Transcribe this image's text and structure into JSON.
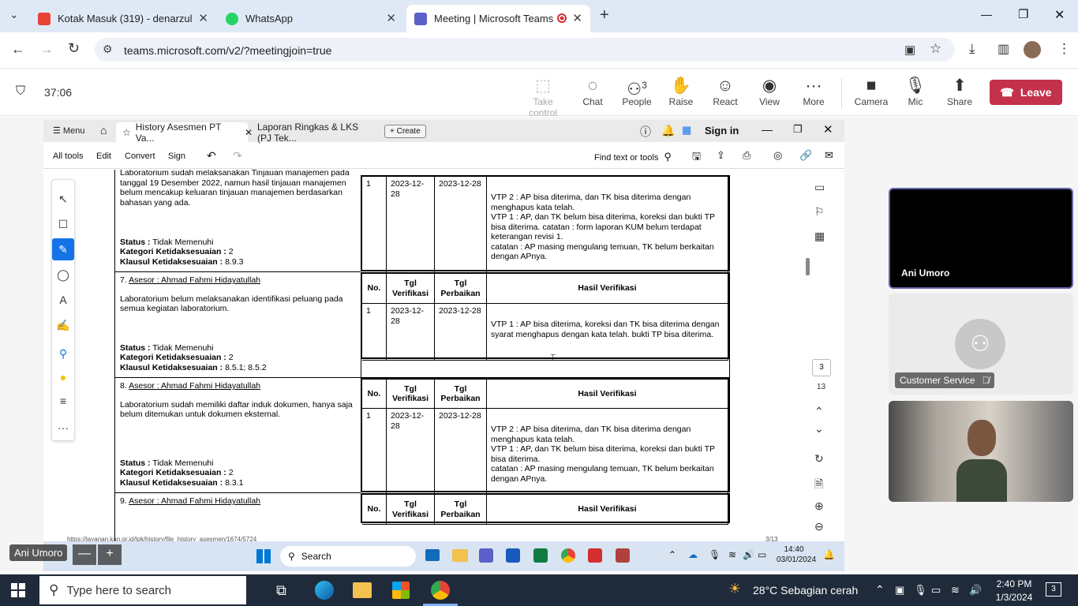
{
  "browser": {
    "tabs": [
      {
        "title": "Kotak Masuk (319) - denarzulia",
        "icon": "gmail-icon",
        "color": "#ea4335"
      },
      {
        "title": "WhatsApp",
        "icon": "whatsapp-icon",
        "color": "#25d366"
      },
      {
        "title": "Meeting | Microsoft Teams",
        "icon": "teams-icon",
        "color": "#5b5fc7"
      }
    ],
    "new_tab": "+",
    "url": "teams.microsoft.com/v2/?meetingjoin=true",
    "window_controls": {
      "minimize": "—",
      "restore": "❐",
      "close": "✕"
    }
  },
  "meeting": {
    "timer": "37:06",
    "buttons": [
      {
        "label": "Take control",
        "icon": "take-control-icon",
        "glyph": "⬚"
      },
      {
        "label": "Chat",
        "icon": "chat-icon",
        "glyph": "💬"
      },
      {
        "label": "People",
        "icon": "people-icon",
        "glyph": "👤",
        "count": "3"
      },
      {
        "label": "Raise",
        "icon": "raise-hand-icon",
        "glyph": "✋"
      },
      {
        "label": "React",
        "icon": "react-icon",
        "glyph": "☺"
      },
      {
        "label": "View",
        "icon": "view-icon",
        "glyph": "◉"
      },
      {
        "label": "More",
        "icon": "more-icon",
        "glyph": "···"
      },
      {
        "label": "Camera",
        "icon": "camera-icon",
        "glyph": "▶"
      },
      {
        "label": "Mic",
        "icon": "mic-icon",
        "glyph": "🎙"
      },
      {
        "label": "Share",
        "icon": "share-icon",
        "glyph": "⬆"
      }
    ],
    "leave": "Leave"
  },
  "acrobat": {
    "menu": "Menu",
    "tabs": [
      "History Asesmen PT Va...",
      "Laporan Ringkas & LKS (PJ Tek..."
    ],
    "create": "+ Create",
    "sign_in": "Sign in",
    "toolbar": [
      "All tools",
      "Edit",
      "Convert",
      "Sign"
    ],
    "find": "Find text or tools",
    "page_current": "3",
    "page_total": "13",
    "footer_url": "https://layanan.kan.or.id/lpk/history/file_history_asesmen/1674/5724",
    "footer_page": "3/13"
  },
  "document": {
    "first": {
      "text": "Laboratorium sudah melaksanakan Tinjauan manajemen pada tanggal 19 Desember 2022, namun hasil tinjauan manajemen belum mencakup keluaran tinjauan manajemen berdasarkan bahasan yang ada.",
      "status": "Tidak Memenuhi",
      "kategori": "2",
      "klausul": "8.9.3",
      "no": "1",
      "tgl_ver": "2023-12-28",
      "tgl_per": "2023-12-28",
      "hasil": "VTP 2 : AP bisa diterima, dan TK bisa diterima dengan menghapus kata telah.\nVTP 1 : AP, dan TK belum bisa diterima, koreksi dan bukti TP bisa diterima. catatan : form laporan KUM belum terdapat keterangan revisi 1.\ncatatan : AP masing mengulang temuan, TK belum berkaitan dengan APnya."
    },
    "labels": {
      "status": "Status :",
      "kategori": "Kategori Ketidaksesuaian :",
      "klausul": "Klausul Ketidaksesuaian :",
      "no": "No.",
      "tgl_ver": "Tgl Verifikasi",
      "tgl_per": "Tgl Perbaikan",
      "hasil": "Hasil Verifikasi",
      "asesor": "Asesor : Ahmad Fahmi Hidayatullah"
    },
    "items": [
      {
        "num": "7.",
        "text": "Laboratorium belum melaksanakan identifikasi peluang pada semua kegiatan laboratorium.",
        "status": "Tidak Memenuhi",
        "kategori": "2",
        "klausul": "8.5.1; 8.5.2",
        "no": "1",
        "tgl_ver": "2023-12-28",
        "tgl_per": "2023-12-28",
        "hasil": "VTP 1 : AP bisa diterima, koreksi dan TK bisa diterima dengan syarat menghapus dengan kata telah. bukti TP bisa diterima."
      },
      {
        "num": "8.",
        "text": "Laboratorium sudah memiliki daftar induk dokumen, hanya saja belum ditemukan untuk dokumen eksternal.",
        "status": "Tidak Memenuhi",
        "kategori": "2",
        "klausul": "8.3.1",
        "no": "1",
        "tgl_ver": "2023-12-28",
        "tgl_per": "2023-12-28",
        "hasil": "VTP 2 : AP bisa diterima, dan TK bisa diterima dengan menghapus kata telah.\nVTP 1 : AP, dan TK belum bisa diterima, koreksi dan bukti TP bisa diterima.\ncatatan : AP masing mengulang temuan, TK belum berkaitan dengan APnya."
      },
      {
        "num": "9."
      }
    ]
  },
  "participants": [
    {
      "name": "Ani Umoro"
    },
    {
      "name": "Customer Service"
    },
    {
      "name": ""
    }
  ],
  "vm_taskbar": {
    "search": "Search",
    "time": "14:40",
    "date": "03/01/2024",
    "sharer": "Ani Umoro"
  },
  "windows": {
    "search": "Type here to search",
    "weather": "28°C Sebagian cerah",
    "time": "2:40 PM",
    "date": "1/3/2024",
    "notifications": "3"
  }
}
